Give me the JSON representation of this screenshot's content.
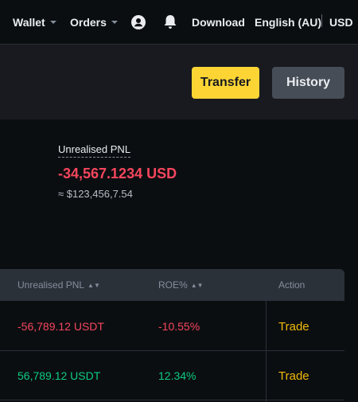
{
  "nav": {
    "wallet": "Wallet",
    "orders": "Orders",
    "download": "Download",
    "language": "English (AU)",
    "currency": "USD"
  },
  "actions": {
    "transfer": "Transfer",
    "history": "History"
  },
  "summary": {
    "label": "Unrealised PNL",
    "value": "-34,567.1234 USD",
    "approx": "≈ $123,456,7.54"
  },
  "table": {
    "headers": {
      "pnl": "Unrealised PNL",
      "roe": "ROE%",
      "action": "Action"
    },
    "rows": [
      {
        "pnl": "-56,789.12 USDT",
        "roe": "-10.55%",
        "action": "Trade"
      },
      {
        "pnl": "56,789.12 USDT",
        "roe": "12.34%",
        "action": "Trade"
      }
    ]
  },
  "colors": {
    "accent": "#fcd535",
    "negative": "#f6465d",
    "positive": "#0ecb81",
    "trade": "#f0b90b"
  }
}
